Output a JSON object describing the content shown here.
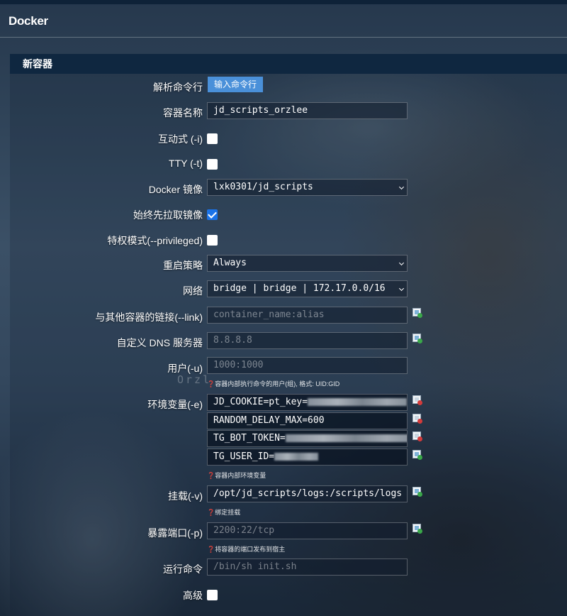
{
  "app_title": "Docker",
  "section_title": "新容器",
  "watermark": "Orzl",
  "parse_command": {
    "label": "解析命令行",
    "button": "输入命令行"
  },
  "container_name": {
    "label": "容器名称",
    "value": "jd_scripts_orzlee"
  },
  "interactive": {
    "label": "互动式 (-i)",
    "checked": false
  },
  "tty": {
    "label": "TTY (-t)",
    "checked": false
  },
  "image": {
    "label": "Docker 镜像",
    "selected": "lxk0301/jd_scripts"
  },
  "always_pull": {
    "label": "始终先拉取镜像",
    "checked": true
  },
  "privileged": {
    "label": "特权模式(--privileged)",
    "checked": false
  },
  "restart_policy": {
    "label": "重启策略",
    "selected": "Always"
  },
  "network": {
    "label": "网络",
    "selected": "bridge | bridge | 172.17.0.0/16"
  },
  "link": {
    "label": "与其他容器的链接(--link)",
    "placeholder": "container_name:alias"
  },
  "dns": {
    "label": "自定义 DNS 服务器",
    "placeholder": "8.8.8.8"
  },
  "user": {
    "label": "用户(-u)",
    "placeholder": "1000:1000",
    "hint": "❓容器内部执行命令的用户(组), 格式: UID:GID"
  },
  "env": {
    "label": "环境变量(-e)",
    "items": [
      {
        "value": "JD_COOKIE=pt_key="
      },
      {
        "value": "RANDOM_DELAY_MAX=600"
      },
      {
        "value": "TG_BOT_TOKEN="
      },
      {
        "value": "TG_USER_ID="
      }
    ],
    "hint": "❓容器内部环境变量"
  },
  "volume": {
    "label": "挂载(-v)",
    "value": "/opt/jd_scripts/logs:/scripts/logs",
    "hint": "❓绑定挂载"
  },
  "ports": {
    "label": "暴露端口(-p)",
    "placeholder": "2200:22/tcp",
    "hint": "❓将容器的端口发布到宿主"
  },
  "command": {
    "label": "运行命令",
    "placeholder": "/bin/sh init.sh"
  },
  "advanced": {
    "label": "高级",
    "checked": false
  }
}
